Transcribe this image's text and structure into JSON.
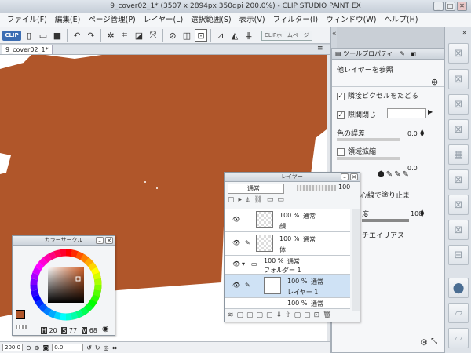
{
  "window": {
    "title": "9_cover02_1* (3507 x 2894px 350dpi 200.0%) - CLIP STUDIO PAINT EX"
  },
  "menu": [
    "ファイル(F)",
    "編集(E)",
    "ページ管理(P)",
    "レイヤー(L)",
    "選択範囲(S)",
    "表示(V)",
    "フィルター(I)",
    "ウィンドウ(W)",
    "ヘルプ(H)"
  ],
  "toolbar": {
    "logo": "CLIP",
    "home_label": "CLIPホームページ"
  },
  "document": {
    "tab_label": "9_cover02_1*",
    "fill_color": "#b0562a"
  },
  "status": {
    "zoom": "200.0",
    "rotation": "0.0"
  },
  "tool_property": {
    "tab_label": "ツールプロパティ",
    "ref_layer": "他レイヤーを参照",
    "follow_pixel": "隣接ピクセルをたどる",
    "close_gap": "隙間閉じ",
    "color_margin": "色の誤差",
    "color_margin_value": "0.0",
    "area_scaling": "領域拡縮",
    "area_scaling_value": "0.0",
    "center_line": "ターの中心線で塗り止ま",
    "opacity_label": "度",
    "opacity_value": "100",
    "antialias": "チエイリアス"
  },
  "layer_panel": {
    "title": "レイヤー",
    "blend_mode": "通常",
    "opacity": "100",
    "layers": [
      {
        "percent": "100 %",
        "mode": "通常",
        "name": "顔"
      },
      {
        "percent": "100 %",
        "mode": "通常",
        "name": "体"
      },
      {
        "percent": "100 %",
        "mode": "通常",
        "name": "フォルダー 1"
      },
      {
        "percent": "100 %",
        "mode": "通常",
        "name": "レイヤー 1"
      },
      {
        "percent": "100 %",
        "mode": "通常",
        "name": ""
      }
    ]
  },
  "color_panel": {
    "title": "カラーサークル",
    "h_label": "H",
    "h_value": "20",
    "s_label": "S",
    "s_value": "77",
    "v_label": "V",
    "v_value": "68",
    "main_color": "#b0562a"
  }
}
